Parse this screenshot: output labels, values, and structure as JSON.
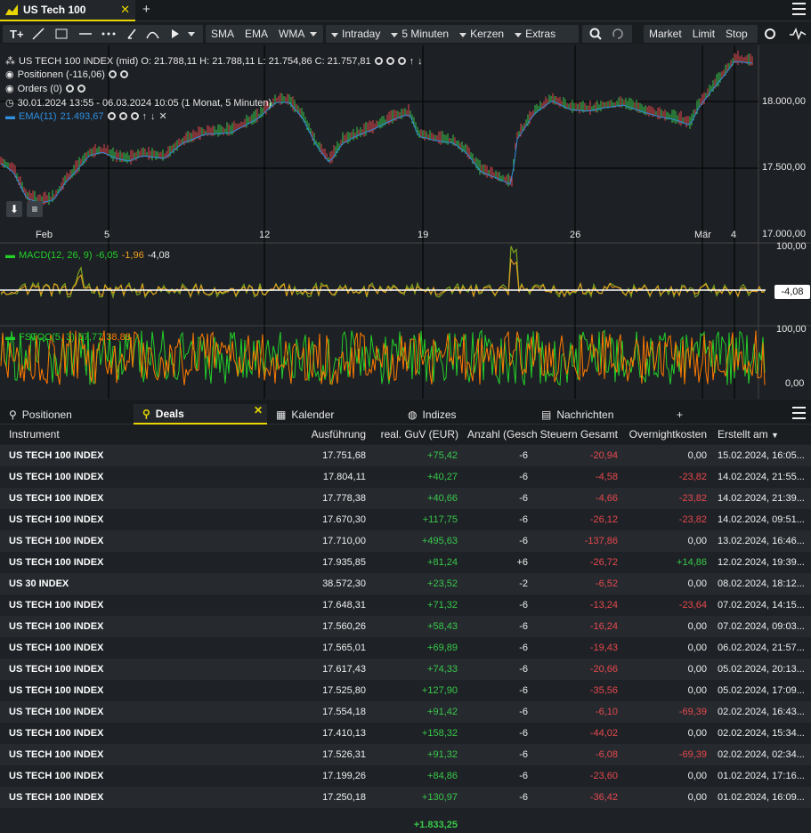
{
  "tab": {
    "title": "US Tech 100",
    "close": "✕",
    "add": "+"
  },
  "toolbar": {
    "indicators": [
      "SMA",
      "EMA",
      "WMA"
    ],
    "interval": "Intraday",
    "period": "5 Minuten",
    "chart_type": "Kerzen",
    "extras": "Extras",
    "orders": [
      "Market",
      "Limit",
      "Stop"
    ]
  },
  "chart": {
    "instrument_line": "US TECH 100 INDEX (mid) O: 21.788,11  H: 21.788,11  L: 21.754,86  C: 21.757,81",
    "positions": "Positionen (-116,06)",
    "orders": "Orders (0)",
    "range": "30.01.2024 13:55 - 06.03.2024 10:05   (1 Monat, 5 Minuten)",
    "ema_label": "EMA(11)",
    "ema_value": "21.493,67",
    "y_ticks": [
      "18.000,00",
      "17.500,00",
      "17.000,00"
    ],
    "x_ticks": [
      "Feb",
      "5",
      "12",
      "19",
      "26",
      "Mär",
      "4"
    ],
    "macd_label": "MACD(12, 26, 9)",
    "macd_v1": "-6,05",
    "macd_v2": "-1,96",
    "macd_v3": "-4,08",
    "macd_top": "100,00",
    "macd_marker": "-4,08",
    "fstoc_label": "FSTOC(5, 3)",
    "fstoc_v1": "57,77",
    "fstoc_v2": "38,88",
    "fstoc_top": "100,00",
    "fstoc_bottom": "0,00",
    "colors": {
      "up": "#39c84a",
      "down": "#e5484d",
      "ema": "#2f8fe0",
      "macd": "#7ba31f",
      "signal": "#f0a020",
      "fstoc_k": "#23d02a",
      "fstoc_d": "#ff7a00"
    }
  },
  "panel_tabs": [
    {
      "label": "Positionen",
      "icon": "pin-icon"
    },
    {
      "label": "Deals",
      "icon": "pin-icon",
      "active": true
    },
    {
      "label": "Kalender",
      "icon": "calendar-icon"
    },
    {
      "label": "Indizes",
      "icon": "globe-icon"
    },
    {
      "label": "Nachrichten",
      "icon": "news-icon"
    }
  ],
  "table": {
    "headers": [
      "Instrument",
      "Ausführung",
      "real. GuV (EUR)",
      "Anzahl (Geschl",
      "Steuern Gesamt",
      "Overnightkosten",
      "Erstellt am"
    ],
    "rows": [
      [
        "US TECH 100 INDEX",
        "17.751,68",
        "+75,42",
        "-6",
        "-20,94",
        "0,00",
        "15.02.2024, 16:05..."
      ],
      [
        "US TECH 100 INDEX",
        "17.804,11",
        "+40,27",
        "-6",
        "-4,58",
        "-23,82",
        "14.02.2024, 21:55..."
      ],
      [
        "US TECH 100 INDEX",
        "17.778,38",
        "+40,66",
        "-6",
        "-4,66",
        "-23,82",
        "14.02.2024, 21:39..."
      ],
      [
        "US TECH 100 INDEX",
        "17.670,30",
        "+117,75",
        "-6",
        "-26,12",
        "-23,82",
        "14.02.2024, 09:51..."
      ],
      [
        "US TECH 100 INDEX",
        "17.710,00",
        "+495,63",
        "-6",
        "-137,86",
        "0,00",
        "13.02.2024, 16:46..."
      ],
      [
        "US TECH 100 INDEX",
        "17.935,85",
        "+81,24",
        "+6",
        "-26,72",
        "+14,86",
        "12.02.2024, 19:39..."
      ],
      [
        "US 30 INDEX",
        "38.572,30",
        "+23,52",
        "-2",
        "-6,52",
        "0,00",
        "08.02.2024, 18:12..."
      ],
      [
        "US TECH 100 INDEX",
        "17.648,31",
        "+71,32",
        "-6",
        "-13,24",
        "-23,64",
        "07.02.2024, 14:15..."
      ],
      [
        "US TECH 100 INDEX",
        "17.560,26",
        "+58,43",
        "-6",
        "-16,24",
        "0,00",
        "07.02.2024, 09:03..."
      ],
      [
        "US TECH 100 INDEX",
        "17.565,01",
        "+69,89",
        "-6",
        "-19,43",
        "0,00",
        "06.02.2024, 21:57..."
      ],
      [
        "US TECH 100 INDEX",
        "17.617,43",
        "+74,33",
        "-6",
        "-20,66",
        "0,00",
        "05.02.2024, 20:13..."
      ],
      [
        "US TECH 100 INDEX",
        "17.525,80",
        "+127,90",
        "-6",
        "-35,56",
        "0,00",
        "05.02.2024, 17:09..."
      ],
      [
        "US TECH 100 INDEX",
        "17.554,18",
        "+91,42",
        "-6",
        "-6,10",
        "-69,39",
        "02.02.2024, 16:43..."
      ],
      [
        "US TECH 100 INDEX",
        "17.410,13",
        "+158,32",
        "-6",
        "-44,02",
        "0,00",
        "02.02.2024, 15:34..."
      ],
      [
        "US TECH 100 INDEX",
        "17.526,31",
        "+91,32",
        "-6",
        "-6,08",
        "-69,39",
        "02.02.2024, 02:34..."
      ],
      [
        "US TECH 100 INDEX",
        "17.199,26",
        "+84,86",
        "-6",
        "-23,60",
        "0,00",
        "01.02.2024, 17:16..."
      ],
      [
        "US TECH 100 INDEX",
        "17.250,18",
        "+130,97",
        "-6",
        "-36,42",
        "0,00",
        "01.02.2024, 16:09..."
      ]
    ],
    "total": "+1.833,25"
  }
}
